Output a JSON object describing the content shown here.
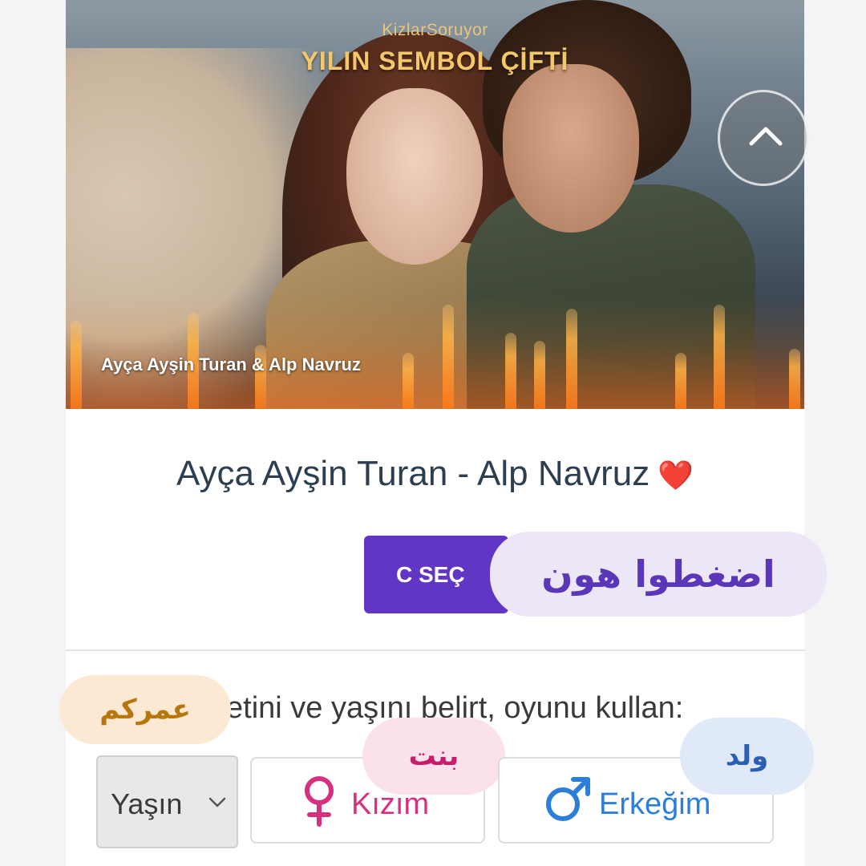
{
  "hero": {
    "brand": "KizlarSoruyor",
    "title": "YILIN SEMBOL ÇİFTİ",
    "caption": "Ayça Ayşin Turan & Alp Navruz"
  },
  "option": {
    "title": "Ayça Ayşin Turan - Alp Navruz",
    "heart": "❤️",
    "select_label": "C SEÇ"
  },
  "overlays": {
    "press_here": "اضغطوا هون",
    "your_age": "عمركم",
    "girl": "بنت",
    "boy": "ولد"
  },
  "form": {
    "prompt": "etini ve yaşını belirt, oyunu kullan:",
    "age_select": "Yaşın",
    "female_label": "Kızım",
    "male_label": "Erkeğim"
  },
  "colors": {
    "select_button": "#6236c4",
    "female": "#d6317f",
    "male": "#2b7fd8",
    "title_text": "#2c3e50"
  },
  "icons": {
    "scroll_up": "chevron-up-icon",
    "female": "female-symbol-icon",
    "male": "male-symbol-icon",
    "dropdown": "chevron-down-icon"
  }
}
